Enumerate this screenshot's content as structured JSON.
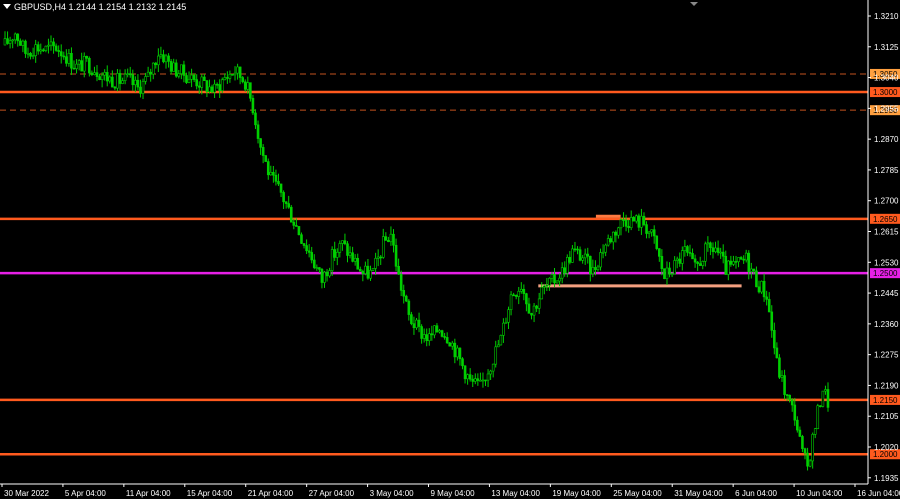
{
  "chart_data": {
    "type": "candlestick",
    "symbol": "GBPUSD,H4",
    "ohlc_header": [
      "1.2144",
      "1.2154",
      "1.2132",
      "1.2145"
    ],
    "y_ticks": [
      "1.3210",
      "1.3125",
      "1.3040",
      "1.2955",
      "1.2870",
      "1.2785",
      "1.2700",
      "1.2615",
      "1.2530",
      "1.2445",
      "1.2360",
      "1.2275",
      "1.2190",
      "1.2105",
      "1.2020",
      "1.1935"
    ],
    "x_ticks": [
      "30 Mar 2022",
      "5 Apr 04:00",
      "11 Apr 04:00",
      "15 Apr 04:00",
      "21 Apr 04:00",
      "27 Apr 04:00",
      "3 May 04:00",
      "9 May 04:00",
      "13 May 04:00",
      "19 May 04:00",
      "25 May 04:00",
      "31 May 04:00",
      "6 Jun 04:00",
      "10 Jun 04:00",
      "16 Jun 04:00"
    ],
    "ylim": [
      1.1905,
      1.325
    ],
    "levels": [
      {
        "value": 1.305,
        "label": "1.3050",
        "style": "dashed",
        "color": "#c2521e"
      },
      {
        "value": 1.3,
        "label": "1.3000",
        "style": "solid",
        "color": "#ff5a1e"
      },
      {
        "value": 1.295,
        "label": "1.2950",
        "style": "dashed",
        "color": "#c2521e"
      },
      {
        "value": 1.265,
        "label": "1.2650",
        "style": "solid",
        "color": "#ff5a1e"
      },
      {
        "value": 1.25,
        "label": "1.2500",
        "style": "solid",
        "color": "#e620e6"
      },
      {
        "value": 1.215,
        "label": "1.2150",
        "style": "solid",
        "color": "#ff5a1e"
      },
      {
        "value": 1.2,
        "label": "1.2000",
        "style": "solid",
        "color": "#ff5a1e"
      }
    ],
    "segments": [
      {
        "from_index": 0.648,
        "to_index": 0.895,
        "value": 1.2465,
        "color": "#f4a080"
      },
      {
        "from_index": 0.718,
        "to_index": 0.748,
        "value": 1.2657,
        "color": "#ff7a40"
      }
    ],
    "path_points": [
      [
        0,
        1.313
      ],
      [
        4,
        1.3165
      ],
      [
        8,
        1.311
      ],
      [
        12,
        1.3125
      ],
      [
        16,
        1.3118
      ],
      [
        20,
        1.3125
      ],
      [
        24,
        1.31
      ],
      [
        28,
        1.307
      ],
      [
        32,
        1.308
      ],
      [
        36,
        1.306
      ],
      [
        40,
        1.304
      ],
      [
        44,
        1.303
      ],
      [
        48,
        1.3035
      ],
      [
        52,
        1.301
      ],
      [
        56,
        1.304
      ],
      [
        60,
        1.311
      ],
      [
        62,
        1.31
      ],
      [
        66,
        1.3065
      ],
      [
        70,
        1.305
      ],
      [
        74,
        1.3035
      ],
      [
        78,
        1.302
      ],
      [
        82,
        1.3005
      ],
      [
        86,
        1.304
      ],
      [
        90,
        1.306
      ],
      [
        94,
        1.303
      ],
      [
        97,
        1.296
      ],
      [
        100,
        1.285
      ],
      [
        104,
        1.276
      ],
      [
        108,
        1.272
      ],
      [
        112,
        1.266
      ],
      [
        116,
        1.26
      ],
      [
        120,
        1.2545
      ],
      [
        124,
        1.248
      ],
      [
        128,
        1.2545
      ],
      [
        132,
        1.258
      ],
      [
        136,
        1.254
      ],
      [
        140,
        1.25
      ],
      [
        144,
        1.25
      ],
      [
        148,
        1.258
      ],
      [
        151,
        1.261
      ],
      [
        154,
        1.249
      ],
      [
        158,
        1.238
      ],
      [
        162,
        1.234
      ],
      [
        166,
        1.232
      ],
      [
        170,
        1.235
      ],
      [
        174,
        1.232
      ],
      [
        178,
        1.226
      ],
      [
        182,
        1.22
      ],
      [
        186,
        1.2185
      ],
      [
        190,
        1.225
      ],
      [
        194,
        1.232
      ],
      [
        198,
        1.244
      ],
      [
        202,
        1.247
      ],
      [
        206,
        1.239
      ],
      [
        210,
        1.245
      ],
      [
        214,
        1.2475
      ],
      [
        218,
        1.2505
      ],
      [
        222,
        1.256
      ],
      [
        226,
        1.2545
      ],
      [
        230,
        1.2505
      ],
      [
        234,
        1.257
      ],
      [
        238,
        1.261
      ],
      [
        242,
        1.265
      ],
      [
        246,
        1.2645
      ],
      [
        250,
        1.264
      ],
      [
        254,
        1.259
      ],
      [
        258,
        1.249
      ],
      [
        262,
        1.252
      ],
      [
        266,
        1.256
      ],
      [
        270,
        1.251
      ],
      [
        274,
        1.256
      ],
      [
        278,
        1.257
      ],
      [
        282,
        1.251
      ],
      [
        286,
        1.252
      ],
      [
        290,
        1.254
      ],
      [
        294,
        1.248
      ],
      [
        298,
        1.244
      ],
      [
        302,
        1.225
      ],
      [
        306,
        1.2155
      ],
      [
        309,
        1.211
      ],
      [
        312,
        1.2
      ],
      [
        314,
        1.1965
      ],
      [
        317,
        1.208
      ],
      [
        320,
        1.2185
      ],
      [
        322,
        1.2145
      ]
    ]
  }
}
